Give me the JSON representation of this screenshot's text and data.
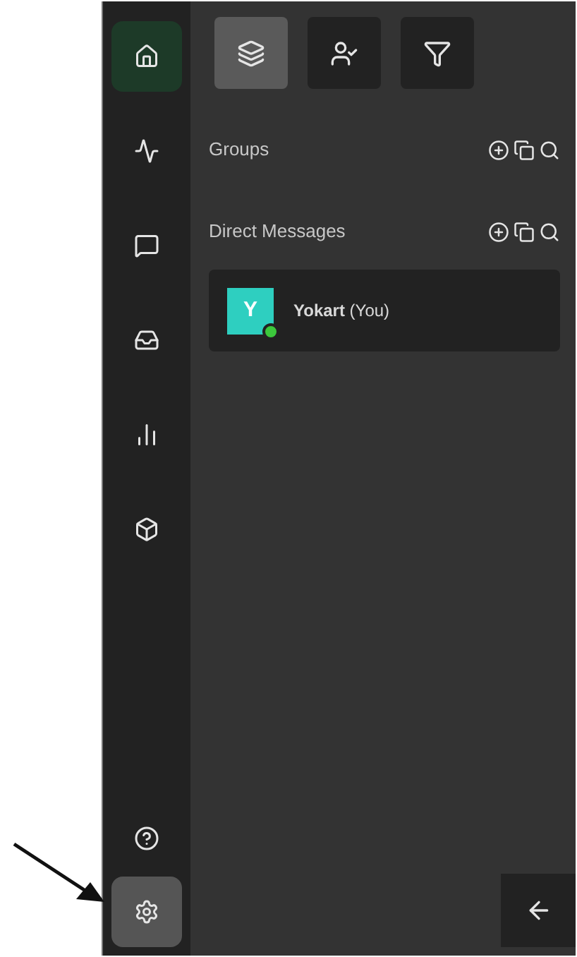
{
  "rail": {
    "top": [
      {
        "kind": "home",
        "selected": true
      },
      {
        "kind": "activity",
        "selected": false
      },
      {
        "kind": "chat",
        "selected": false
      },
      {
        "kind": "inbox",
        "selected": false
      },
      {
        "kind": "stats",
        "selected": false
      },
      {
        "kind": "box",
        "selected": false
      }
    ],
    "bottom": [
      {
        "kind": "help",
        "selected": false
      },
      {
        "kind": "settings",
        "selected": true
      }
    ]
  },
  "tabs": [
    {
      "kind": "layers",
      "selected": true
    },
    {
      "kind": "user-check",
      "selected": false
    },
    {
      "kind": "filter",
      "selected": false
    }
  ],
  "sections": [
    {
      "title": "Groups"
    },
    {
      "title": "Direct Messages",
      "items": [
        {
          "initial": "Y",
          "name": "**Yokart** (You)",
          "online": true
        }
      ]
    }
  ],
  "annotation": {
    "kind": "arrow"
  }
}
